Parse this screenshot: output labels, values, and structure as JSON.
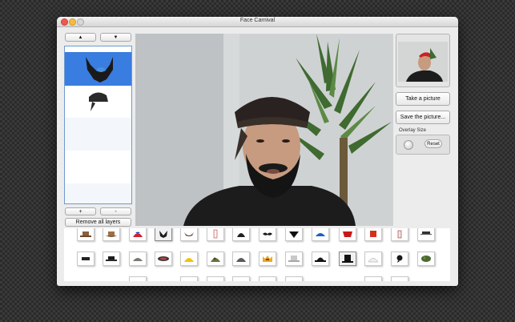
{
  "window": {
    "title": "Face Carnival"
  },
  "layers": {
    "up_label": "▲",
    "down_label": "▼",
    "add_label": "+",
    "remove_label": "-",
    "remove_all_label": "Remove all layers",
    "items": [
      "beard",
      "bandana"
    ]
  },
  "actions": {
    "take_picture": "Take a picture",
    "save_picture": "Save the picture..."
  },
  "overlay": {
    "label": "Overlay Size",
    "reset": "Reset"
  },
  "tray_items_row1": [
    "hat",
    "cowboy-hat",
    "cap",
    "beard",
    "mustache-beard",
    "paper",
    "helmet",
    "mustache",
    "bandana",
    "cap-blue",
    "cap-red",
    "fez",
    "hat-red",
    "cap-gray"
  ],
  "tray_items_row2": [
    "glasses",
    "hat-black",
    "army-helmet",
    "cap-dark",
    "hard-hat",
    "camo-helmet",
    "soldier-helmet",
    "crown",
    "top-hat-gray",
    "bowler",
    "top-hat",
    "cap-white",
    "bandana-black",
    "camo-hat"
  ],
  "colors": {
    "accent": "#3a7de0",
    "list_border": "#6e9ad0"
  }
}
